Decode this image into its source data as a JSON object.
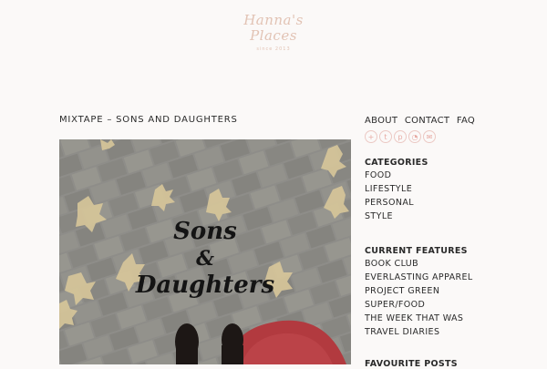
{
  "site": {
    "logo_line1": "Hanna's",
    "logo_line2": "Places",
    "logo_line3": "since 2013"
  },
  "post": {
    "title": "MIXTAPE – SONS AND DAUGHTERS",
    "image_text_line1": "Sons",
    "image_text_line2": "&",
    "image_text_line3": "Daughters"
  },
  "sidebar": {
    "nav": [
      "ABOUT",
      "CONTACT",
      "FAQ"
    ],
    "social_icons": [
      "plus-icon",
      "twitter-icon",
      "pinterest-icon",
      "rss-icon",
      "mail-icon"
    ],
    "categories_title": "CATEGORIES",
    "categories": [
      "FOOD",
      "LIFESTYLE",
      "PERSONAL",
      "STYLE"
    ],
    "features_title": "CURRENT FEATURES",
    "features": [
      "BOOK CLUB",
      "EVERLASTING APPAREL",
      "PROJECT GREEN",
      "SUPER/FOOD",
      "THE WEEK THAT WAS",
      "TRAVEL DIARIES"
    ],
    "next_title": "FAVOURITE POSTS"
  },
  "colors": {
    "background": "#fbf9f8",
    "accent": "#e7aaa3",
    "logo": "#e2c3b4"
  }
}
